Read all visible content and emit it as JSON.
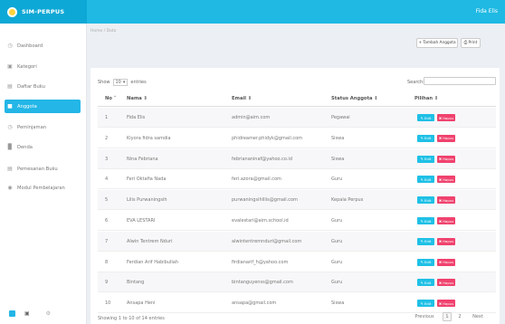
{
  "app": {
    "title": "SIM-PERPUS",
    "user": "Fida Elis"
  },
  "breadcrumb": "Home / Data",
  "sidebar": {
    "items": [
      {
        "label": "Dashboard",
        "icon": "dashboard-icon"
      },
      {
        "label": "Kategori",
        "icon": "folder-icon"
      },
      {
        "label": "Daftar Buku",
        "icon": "book-icon"
      },
      {
        "label": "Anggota",
        "icon": "users-icon",
        "active": true
      },
      {
        "label": "Peminjaman",
        "icon": "clock-icon"
      },
      {
        "label": "Denda",
        "icon": "chart-icon"
      },
      {
        "label": "Pemesanan Buku",
        "icon": "cart-icon"
      },
      {
        "label": "Modul Pembelajaran",
        "icon": "module-icon"
      }
    ]
  },
  "toolbar": {
    "add_label": "+ Tambah Anggota",
    "print_label": "⎙ Print"
  },
  "table_controls": {
    "show_label": "Show",
    "entries_value": "10",
    "entries_label": "entries",
    "search_label": "Search:"
  },
  "table": {
    "headers": [
      "No ˄",
      "Nama ⇕",
      "Email ⇕",
      "Status Anggota ⇕",
      "Pilihan ⇕"
    ],
    "rows": [
      [
        "1",
        "Fida Elis",
        "admin@aim.com",
        "Pegawai"
      ],
      [
        "2",
        "Kiyora fidra samdia",
        "phidreamer.phidyk@gmail.com",
        "Siswa"
      ],
      [
        "3",
        "Nina Febriana",
        "febriananinaf@yahoo.co.id",
        "Siswa"
      ],
      [
        "4",
        "Feri Oktafia Nada",
        "feri.azora@gmail.com",
        "Guru"
      ],
      [
        "5",
        "Lilis Purwaningsih",
        "purwaningsihlilis@gmail.com",
        "Kepala Perpus"
      ],
      [
        "6",
        "EVA LESTARI",
        "evalestari@aim.school.id",
        "Guru"
      ],
      [
        "7",
        "Alwin Tentrem Nduri",
        "alwintentremnduri@gmail.com",
        "Guru"
      ],
      [
        "8",
        "Ferdian Arif Habibullah",
        "firdianarif_h@yahoo.com",
        "Guru"
      ],
      [
        "9",
        "Bintang",
        "bintanguyenss@gmail.com",
        "Guru"
      ],
      [
        "10",
        "Ansapa Heni",
        "ansapa@gmail.com",
        "Siswa"
      ]
    ],
    "edit_label": "✎ Edit",
    "delete_label": "✖ Hapus"
  },
  "footer": {
    "showing": "Showing 1 to 10 of 14 entries",
    "previous": "Previous",
    "pages": [
      "1",
      "2"
    ],
    "next": "Next"
  },
  "colors": {
    "brand": "#1fb9e3",
    "edit": "#1fc0e6",
    "delete": "#f0426e"
  }
}
